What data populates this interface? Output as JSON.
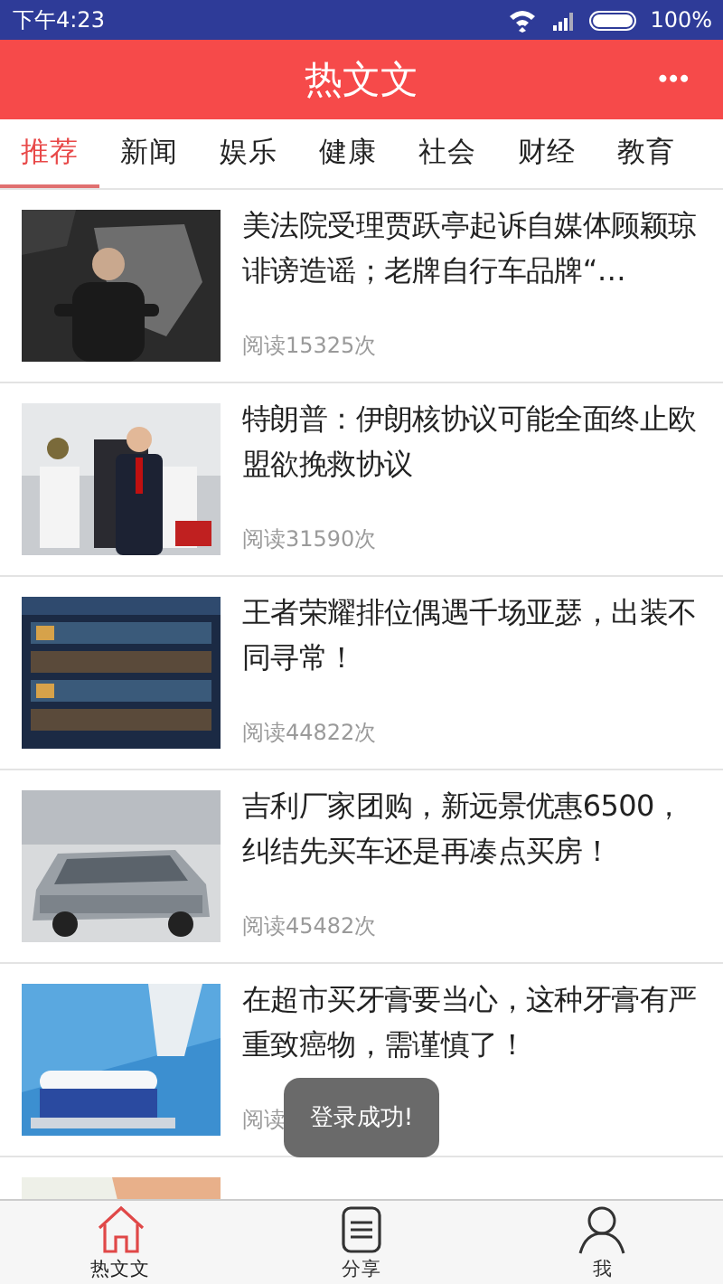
{
  "status_bar": {
    "time": "下午4:23",
    "battery": "100%"
  },
  "header": {
    "title": "热文文",
    "menu": "•••"
  },
  "tabs": [
    {
      "label": "推荐",
      "selected": true
    },
    {
      "label": "新闻",
      "selected": false
    },
    {
      "label": "娱乐",
      "selected": false
    },
    {
      "label": "健康",
      "selected": false
    },
    {
      "label": "社会",
      "selected": false
    },
    {
      "label": "财经",
      "selected": false
    },
    {
      "label": "教育",
      "selected": false
    }
  ],
  "articles": [
    {
      "title": "美法院受理贾跃亭起诉自媒体顾颖琼诽谤造谣；老牌自行车品牌“…",
      "reads": "阅读15325次",
      "image": {
        "kind": "picture"
      }
    },
    {
      "title": "特朗普：伊朗核协议可能全面终止欧盟欲挽救协议",
      "reads": "阅读31590次",
      "image": {
        "kind": "picture"
      }
    },
    {
      "title": "王者荣耀排位偶遇千场亚瑟，出装不同寻常！",
      "reads": "阅读44822次",
      "image": {
        "kind": "picture"
      }
    },
    {
      "title": "吉利厂家团购，新远景优惠6500，纠结先买车还是再凑点买房！",
      "reads": "阅读45482次",
      "image": {
        "kind": "picture"
      }
    },
    {
      "title": "在超市买牙膏要当心，这种牙膏有严重致癌物，需谨慎了！",
      "reads": "阅读",
      "image": {
        "kind": "picture"
      }
    },
    {
      "image": {
        "kind": "picture"
      }
    }
  ],
  "toast": "登录成功!",
  "bottom_nav": [
    {
      "label": "热文文",
      "kind": "home",
      "selected": true
    },
    {
      "label": "分享",
      "kind": "list",
      "selected": false
    },
    {
      "label": "我",
      "kind": "person",
      "selected": false
    }
  ]
}
